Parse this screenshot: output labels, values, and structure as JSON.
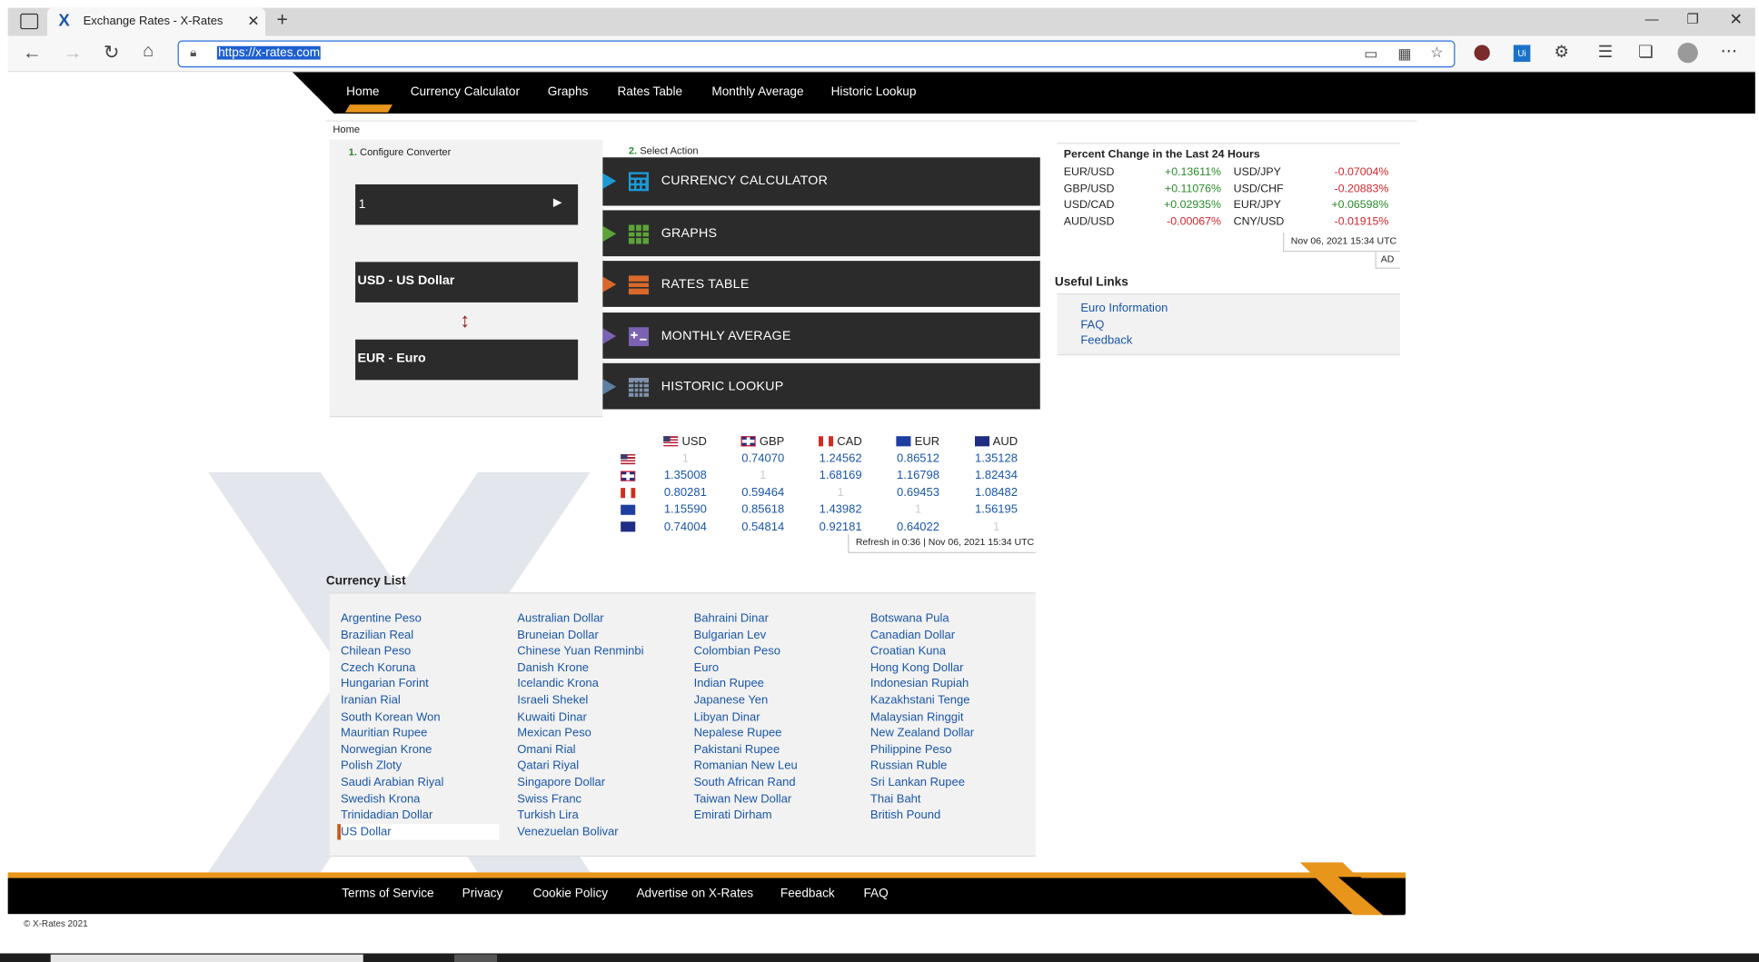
{
  "browser": {
    "tab_title": "Exchange Rates - X-Rates",
    "url": "https://x-rates.com"
  },
  "nav": [
    "Home",
    "Currency Calculator",
    "Graphs",
    "Rates Table",
    "Monthly Average",
    "Historic Lookup"
  ],
  "breadcrumb": "Home",
  "converter": {
    "step_num": "1.",
    "step_label": "Configure Converter",
    "amount": "1",
    "from": "USD - US Dollar",
    "to": "EUR - Euro"
  },
  "actions": {
    "step_num": "2.",
    "step_label": "Select Action",
    "items": [
      {
        "label": "CURRENCY CALCULATOR",
        "color": "#1d9ad6"
      },
      {
        "label": "GRAPHS",
        "color": "#5ba33a"
      },
      {
        "label": "RATES TABLE",
        "color": "#d9692b"
      },
      {
        "label": "MONTHLY AVERAGE",
        "color": "#7b62b3"
      },
      {
        "label": "HISTORIC LOOKUP",
        "color": "#5f7fa2"
      }
    ]
  },
  "rates_table": {
    "headers": [
      "USD",
      "GBP",
      "CAD",
      "EUR",
      "AUD"
    ],
    "rows": [
      [
        "1",
        "0.74070",
        "1.24562",
        "0.86512",
        "1.35128"
      ],
      [
        "1.35008",
        "1",
        "1.68169",
        "1.16798",
        "1.82434"
      ],
      [
        "0.80281",
        "0.59464",
        "1",
        "0.69453",
        "1.08482"
      ],
      [
        "1.15590",
        "0.85618",
        "1.43982",
        "1",
        "1.56195"
      ],
      [
        "0.74004",
        "0.54814",
        "0.92181",
        "0.64022",
        "1"
      ]
    ],
    "refresh": "Refresh in 0:36 | Nov 06, 2021 15:34 UTC"
  },
  "percent_change": {
    "title": "Percent Change in the Last 24 Hours",
    "left": [
      {
        "pair": "EUR/USD",
        "change": "+0.13611%",
        "dir": "up"
      },
      {
        "pair": "GBP/USD",
        "change": "+0.11076%",
        "dir": "up"
      },
      {
        "pair": "USD/CAD",
        "change": "+0.02935%",
        "dir": "up"
      },
      {
        "pair": "AUD/USD",
        "change": "-0.00067%",
        "dir": "down"
      }
    ],
    "right": [
      {
        "pair": "USD/JPY",
        "change": "-0.07004%",
        "dir": "down"
      },
      {
        "pair": "USD/CHF",
        "change": "-0.20883%",
        "dir": "down"
      },
      {
        "pair": "EUR/JPY",
        "change": "+0.06598%",
        "dir": "up"
      },
      {
        "pair": "CNY/USD",
        "change": "-0.01915%",
        "dir": "down"
      }
    ],
    "timestamp": "Nov 06, 2021 15:34 UTC",
    "ad": "AD"
  },
  "useful_links": {
    "title": "Useful Links",
    "items": [
      "Euro Information",
      "FAQ",
      "Feedback"
    ]
  },
  "currency_list": {
    "title": "Currency List",
    "columns": [
      [
        "Argentine Peso",
        "Brazilian Real",
        "Chilean Peso",
        "Czech Koruna",
        "Hungarian Forint",
        "Iranian Rial",
        "South Korean Won",
        "Mauritian Rupee",
        "Norwegian Krone",
        "Polish Zloty",
        "Saudi Arabian Riyal",
        "Swedish Krona",
        "Trinidadian Dollar",
        "US Dollar"
      ],
      [
        "Australian Dollar",
        "Bruneian Dollar",
        "Chinese Yuan Renminbi",
        "Danish Krone",
        "Icelandic Krona",
        "Israeli Shekel",
        "Kuwaiti Dinar",
        "Mexican Peso",
        "Omani Rial",
        "Qatari Riyal",
        "Singapore Dollar",
        "Swiss Franc",
        "Turkish Lira",
        "Venezuelan Bolivar"
      ],
      [
        "Bahraini Dinar",
        "Bulgarian Lev",
        "Colombian Peso",
        "Euro",
        "Indian Rupee",
        "Japanese Yen",
        "Libyan Dinar",
        "Nepalese Rupee",
        "Pakistani Rupee",
        "Romanian New Leu",
        "South African Rand",
        "Taiwan New Dollar",
        "Emirati Dirham"
      ],
      [
        "Botswana Pula",
        "Canadian Dollar",
        "Croatian Kuna",
        "Hong Kong Dollar",
        "Indonesian Rupiah",
        "Kazakhstani Tenge",
        "Malaysian Ringgit",
        "New Zealand Dollar",
        "Philippine Peso",
        "Russian Ruble",
        "Sri Lankan Rupee",
        "Thai Baht",
        "British Pound"
      ]
    ]
  },
  "footer": {
    "links": [
      "Terms of Service",
      "Privacy",
      "Cookie Policy",
      "Advertise on X-Rates",
      "Feedback",
      "FAQ"
    ],
    "copyright": "© X-Rates 2021"
  },
  "colors": {
    "accent": "#e8951c",
    "link": "#1a56a8",
    "up": "#2a8a2a",
    "down": "#d0282e"
  },
  "icons": [
    "sidebar-toggle-icon",
    "x-rates-logo-icon",
    "close-icon",
    "plus-icon",
    "back-icon",
    "forward-icon",
    "refresh-icon",
    "home-icon",
    "lock-icon",
    "read-aloud-icon",
    "apps-icon",
    "favorite-icon",
    "extension-icon",
    "collections-icon",
    "profile-icon",
    "more-icon"
  ]
}
